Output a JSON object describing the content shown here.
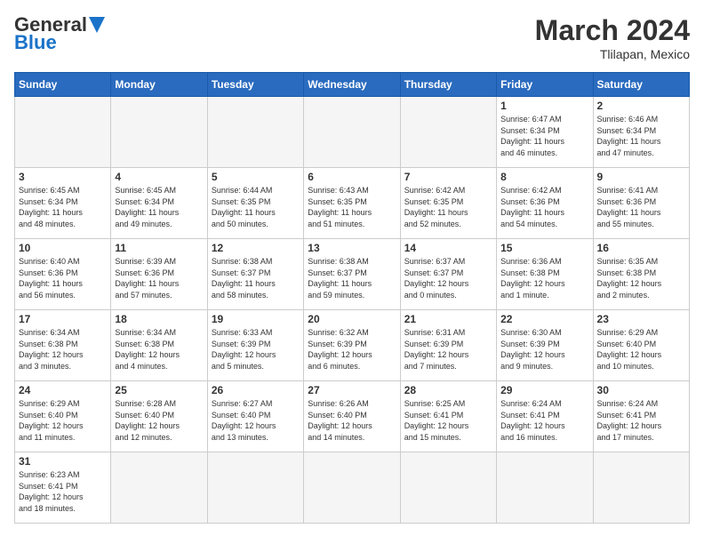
{
  "header": {
    "logo_general": "General",
    "logo_blue": "Blue",
    "month_year": "March 2024",
    "location": "Tlilapan, Mexico"
  },
  "weekdays": [
    "Sunday",
    "Monday",
    "Tuesday",
    "Wednesday",
    "Thursday",
    "Friday",
    "Saturday"
  ],
  "weeks": [
    [
      {
        "day": "",
        "info": ""
      },
      {
        "day": "",
        "info": ""
      },
      {
        "day": "",
        "info": ""
      },
      {
        "day": "",
        "info": ""
      },
      {
        "day": "",
        "info": ""
      },
      {
        "day": "1",
        "info": "Sunrise: 6:47 AM\nSunset: 6:34 PM\nDaylight: 11 hours\nand 46 minutes."
      },
      {
        "day": "2",
        "info": "Sunrise: 6:46 AM\nSunset: 6:34 PM\nDaylight: 11 hours\nand 47 minutes."
      }
    ],
    [
      {
        "day": "3",
        "info": "Sunrise: 6:45 AM\nSunset: 6:34 PM\nDaylight: 11 hours\nand 48 minutes."
      },
      {
        "day": "4",
        "info": "Sunrise: 6:45 AM\nSunset: 6:34 PM\nDaylight: 11 hours\nand 49 minutes."
      },
      {
        "day": "5",
        "info": "Sunrise: 6:44 AM\nSunset: 6:35 PM\nDaylight: 11 hours\nand 50 minutes."
      },
      {
        "day": "6",
        "info": "Sunrise: 6:43 AM\nSunset: 6:35 PM\nDaylight: 11 hours\nand 51 minutes."
      },
      {
        "day": "7",
        "info": "Sunrise: 6:42 AM\nSunset: 6:35 PM\nDaylight: 11 hours\nand 52 minutes."
      },
      {
        "day": "8",
        "info": "Sunrise: 6:42 AM\nSunset: 6:36 PM\nDaylight: 11 hours\nand 54 minutes."
      },
      {
        "day": "9",
        "info": "Sunrise: 6:41 AM\nSunset: 6:36 PM\nDaylight: 11 hours\nand 55 minutes."
      }
    ],
    [
      {
        "day": "10",
        "info": "Sunrise: 6:40 AM\nSunset: 6:36 PM\nDaylight: 11 hours\nand 56 minutes."
      },
      {
        "day": "11",
        "info": "Sunrise: 6:39 AM\nSunset: 6:36 PM\nDaylight: 11 hours\nand 57 minutes."
      },
      {
        "day": "12",
        "info": "Sunrise: 6:38 AM\nSunset: 6:37 PM\nDaylight: 11 hours\nand 58 minutes."
      },
      {
        "day": "13",
        "info": "Sunrise: 6:38 AM\nSunset: 6:37 PM\nDaylight: 11 hours\nand 59 minutes."
      },
      {
        "day": "14",
        "info": "Sunrise: 6:37 AM\nSunset: 6:37 PM\nDaylight: 12 hours\nand 0 minutes."
      },
      {
        "day": "15",
        "info": "Sunrise: 6:36 AM\nSunset: 6:38 PM\nDaylight: 12 hours\nand 1 minute."
      },
      {
        "day": "16",
        "info": "Sunrise: 6:35 AM\nSunset: 6:38 PM\nDaylight: 12 hours\nand 2 minutes."
      }
    ],
    [
      {
        "day": "17",
        "info": "Sunrise: 6:34 AM\nSunset: 6:38 PM\nDaylight: 12 hours\nand 3 minutes."
      },
      {
        "day": "18",
        "info": "Sunrise: 6:34 AM\nSunset: 6:38 PM\nDaylight: 12 hours\nand 4 minutes."
      },
      {
        "day": "19",
        "info": "Sunrise: 6:33 AM\nSunset: 6:39 PM\nDaylight: 12 hours\nand 5 minutes."
      },
      {
        "day": "20",
        "info": "Sunrise: 6:32 AM\nSunset: 6:39 PM\nDaylight: 12 hours\nand 6 minutes."
      },
      {
        "day": "21",
        "info": "Sunrise: 6:31 AM\nSunset: 6:39 PM\nDaylight: 12 hours\nand 7 minutes."
      },
      {
        "day": "22",
        "info": "Sunrise: 6:30 AM\nSunset: 6:39 PM\nDaylight: 12 hours\nand 9 minutes."
      },
      {
        "day": "23",
        "info": "Sunrise: 6:29 AM\nSunset: 6:40 PM\nDaylight: 12 hours\nand 10 minutes."
      }
    ],
    [
      {
        "day": "24",
        "info": "Sunrise: 6:29 AM\nSunset: 6:40 PM\nDaylight: 12 hours\nand 11 minutes."
      },
      {
        "day": "25",
        "info": "Sunrise: 6:28 AM\nSunset: 6:40 PM\nDaylight: 12 hours\nand 12 minutes."
      },
      {
        "day": "26",
        "info": "Sunrise: 6:27 AM\nSunset: 6:40 PM\nDaylight: 12 hours\nand 13 minutes."
      },
      {
        "day": "27",
        "info": "Sunrise: 6:26 AM\nSunset: 6:40 PM\nDaylight: 12 hours\nand 14 minutes."
      },
      {
        "day": "28",
        "info": "Sunrise: 6:25 AM\nSunset: 6:41 PM\nDaylight: 12 hours\nand 15 minutes."
      },
      {
        "day": "29",
        "info": "Sunrise: 6:24 AM\nSunset: 6:41 PM\nDaylight: 12 hours\nand 16 minutes."
      },
      {
        "day": "30",
        "info": "Sunrise: 6:24 AM\nSunset: 6:41 PM\nDaylight: 12 hours\nand 17 minutes."
      }
    ],
    [
      {
        "day": "31",
        "info": "Sunrise: 6:23 AM\nSunset: 6:41 PM\nDaylight: 12 hours\nand 18 minutes."
      },
      {
        "day": "",
        "info": ""
      },
      {
        "day": "",
        "info": ""
      },
      {
        "day": "",
        "info": ""
      },
      {
        "day": "",
        "info": ""
      },
      {
        "day": "",
        "info": ""
      },
      {
        "day": "",
        "info": ""
      }
    ]
  ]
}
